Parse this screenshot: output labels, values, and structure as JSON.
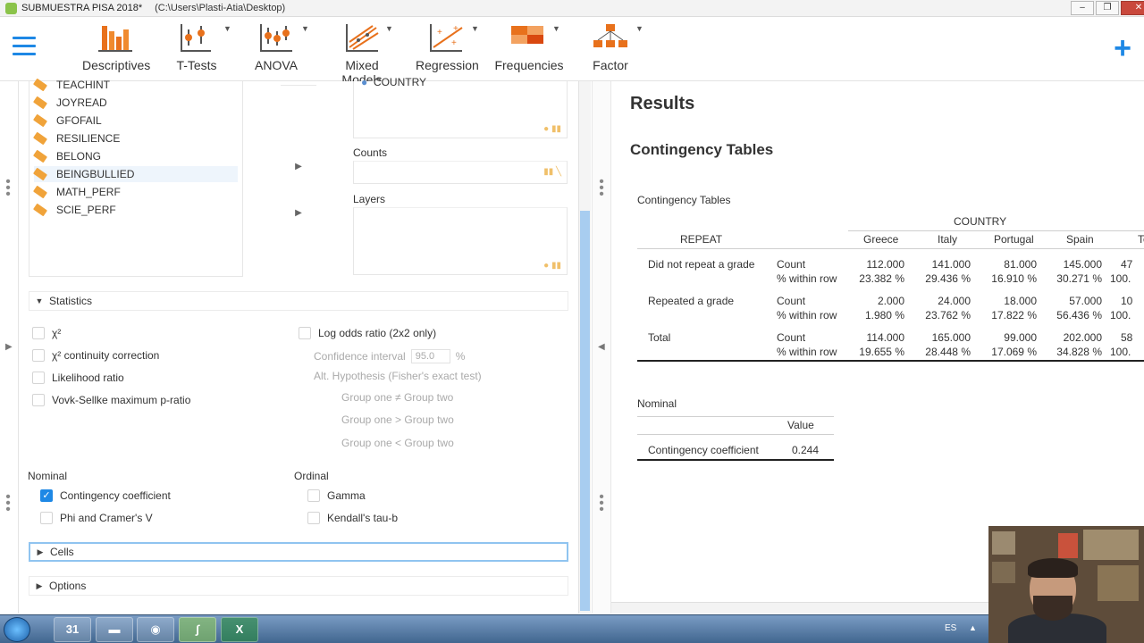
{
  "window": {
    "title": "SUBMUESTRA PISA 2018*",
    "path": "(C:\\Users\\Plasti-Atia\\Desktop)"
  },
  "ribbon": {
    "items": [
      {
        "label": "Descriptives",
        "icon": "bar-chart-icon"
      },
      {
        "label": "T-Tests",
        "icon": "t-test-icon"
      },
      {
        "label": "ANOVA",
        "icon": "anova-icon"
      },
      {
        "label": "Mixed Models",
        "icon": "mixed-models-icon"
      },
      {
        "label": "Regression",
        "icon": "regression-icon"
      },
      {
        "label": "Frequencies",
        "icon": "frequencies-icon"
      },
      {
        "label": "Factor",
        "icon": "factor-icon"
      }
    ],
    "plus": "+"
  },
  "variables": [
    "TEACHINT",
    "JOYREAD",
    "GFOFAIL",
    "RESILIENCE",
    "BELONG",
    "BEINGBULLIED",
    "MATH_PERF",
    "SCIE_PERF"
  ],
  "boxes": {
    "columns_item": "COUNTRY",
    "counts_label": "Counts",
    "layers_label": "Layers"
  },
  "statistics": {
    "header": "Statistics",
    "chi2": "χ²",
    "chi2_cc": "χ² continuity correction",
    "likelihood": "Likelihood ratio",
    "vovk": "Vovk-Sellke maximum p-ratio",
    "log_odds": "Log odds ratio (2x2 only)",
    "ci_label": "Confidence interval",
    "ci_value": "95.0",
    "ci_unit": "%",
    "alt_hyp": "Alt. Hypothesis (Fisher's exact test)",
    "alt_options": [
      "Group one ≠ Group two",
      "Group one > Group two",
      "Group one < Group two"
    ],
    "nominal_label": "Nominal",
    "ordinal_label": "Ordinal",
    "contingency": "Contingency coefficient",
    "phi": "Phi and Cramer's V",
    "gamma": "Gamma",
    "kendall": "Kendall's tau-b"
  },
  "sections": {
    "cells": "Cells",
    "options": "Options"
  },
  "results": {
    "title": "Results",
    "subtitle": "Contingency Tables",
    "table_caption": "Contingency Tables",
    "col_group": "COUNTRY",
    "row_var": "REPEAT",
    "columns": [
      "Greece",
      "Italy",
      "Portugal",
      "Spain",
      "To"
    ],
    "rows": [
      {
        "label": "Did not repeat a grade",
        "count_label": "Count",
        "pct_label": "% within row",
        "counts": [
          "112.000",
          "141.000",
          "81.000",
          "145.000",
          "47"
        ],
        "pcts": [
          "23.382 %",
          "29.436 %",
          "16.910 %",
          "30.271 %",
          "100."
        ]
      },
      {
        "label": "Repeated a grade",
        "count_label": "Count",
        "pct_label": "% within row",
        "counts": [
          "2.000",
          "24.000",
          "18.000",
          "57.000",
          "10"
        ],
        "pcts": [
          "1.980 %",
          "23.762 %",
          "17.822 %",
          "56.436 %",
          "100."
        ]
      },
      {
        "label": "Total",
        "count_label": "Count",
        "pct_label": "% within row",
        "counts": [
          "114.000",
          "165.000",
          "99.000",
          "202.000",
          "58"
        ],
        "pcts": [
          "19.655 %",
          "28.448 %",
          "17.069 %",
          "34.828 %",
          "100."
        ]
      }
    ],
    "nominal_caption": "Nominal",
    "nominal_header": "Value",
    "nominal_row_label": "Contingency coefficient",
    "nominal_row_value": "0.244"
  },
  "taskbar": {
    "calendar_day": "31",
    "lang": "ES"
  }
}
